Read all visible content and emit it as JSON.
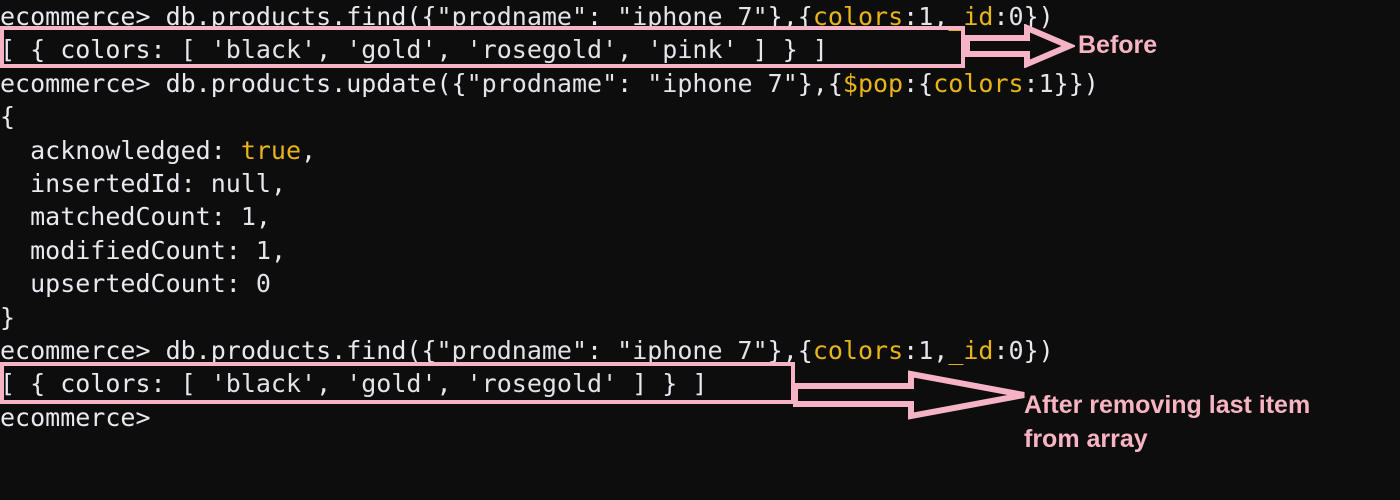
{
  "terminal": {
    "prompt": "ecommerce>",
    "background_color": "#0d0d0d",
    "colors": {
      "text": "#e8e8ee",
      "string": "#00b906",
      "key": "#e8b417",
      "number": "#e8b417",
      "annotation": "#f9b4c4",
      "highlight_border": "#f7b3c6"
    },
    "lines": [
      {
        "id": "l1",
        "kind": "command",
        "segments": [
          {
            "text": "ecommerce> ",
            "type": "prompt"
          },
          {
            "text": "db.products.find({",
            "type": "plain"
          },
          {
            "text": "\"prodname\"",
            "type": "string"
          },
          {
            "text": ": ",
            "type": "plain"
          },
          {
            "text": "\"iphone 7\"",
            "type": "string"
          },
          {
            "text": "},{",
            "type": "plain"
          },
          {
            "text": "colors",
            "type": "key"
          },
          {
            "text": ":",
            "type": "plain"
          },
          {
            "text": "1",
            "type": "number"
          },
          {
            "text": ",",
            "type": "plain"
          },
          {
            "text": "_id",
            "type": "key"
          },
          {
            "text": ":",
            "type": "plain"
          },
          {
            "text": "0",
            "type": "number"
          },
          {
            "text": "})",
            "type": "plain"
          }
        ]
      },
      {
        "id": "l2",
        "kind": "output",
        "segments": [
          {
            "text": "[ { colors: [ ",
            "type": "plain"
          },
          {
            "text": "'black'",
            "type": "string"
          },
          {
            "text": ", ",
            "type": "plain"
          },
          {
            "text": "'gold'",
            "type": "string"
          },
          {
            "text": ", ",
            "type": "plain"
          },
          {
            "text": "'rosegold'",
            "type": "string"
          },
          {
            "text": ", ",
            "type": "plain"
          },
          {
            "text": "'pink'",
            "type": "string"
          },
          {
            "text": " ] } ]",
            "type": "plain"
          }
        ]
      },
      {
        "id": "l3",
        "kind": "command",
        "segments": [
          {
            "text": "ecommerce> ",
            "type": "prompt"
          },
          {
            "text": "db.products.update({",
            "type": "plain"
          },
          {
            "text": "\"prodname\"",
            "type": "string"
          },
          {
            "text": ": ",
            "type": "plain"
          },
          {
            "text": "\"iphone 7\"",
            "type": "string"
          },
          {
            "text": "},{",
            "type": "plain"
          },
          {
            "text": "$pop",
            "type": "key"
          },
          {
            "text": ":{",
            "type": "plain"
          },
          {
            "text": "colors",
            "type": "key"
          },
          {
            "text": ":",
            "type": "plain"
          },
          {
            "text": "1",
            "type": "number"
          },
          {
            "text": "}})",
            "type": "plain"
          }
        ]
      },
      {
        "id": "l4",
        "kind": "output",
        "segments": [
          {
            "text": "{",
            "type": "plain"
          }
        ]
      },
      {
        "id": "l5",
        "kind": "output",
        "segments": [
          {
            "text": "  acknowledged: ",
            "type": "plain"
          },
          {
            "text": "true",
            "type": "bool"
          },
          {
            "text": ",",
            "type": "plain"
          }
        ]
      },
      {
        "id": "l6",
        "kind": "output",
        "segments": [
          {
            "text": "  insertedId: ",
            "type": "plain"
          },
          {
            "text": "null",
            "type": "null"
          },
          {
            "text": ",",
            "type": "plain"
          }
        ]
      },
      {
        "id": "l7",
        "kind": "output",
        "segments": [
          {
            "text": "  matchedCount: ",
            "type": "plain"
          },
          {
            "text": "1",
            "type": "number"
          },
          {
            "text": ",",
            "type": "plain"
          }
        ]
      },
      {
        "id": "l8",
        "kind": "output",
        "segments": [
          {
            "text": "  modifiedCount: ",
            "type": "plain"
          },
          {
            "text": "1",
            "type": "number"
          },
          {
            "text": ",",
            "type": "plain"
          }
        ]
      },
      {
        "id": "l9",
        "kind": "output",
        "segments": [
          {
            "text": "  upsertedCount: ",
            "type": "plain"
          },
          {
            "text": "0",
            "type": "number"
          }
        ]
      },
      {
        "id": "l10",
        "kind": "output",
        "segments": [
          {
            "text": "}",
            "type": "plain"
          }
        ]
      },
      {
        "id": "l11",
        "kind": "command",
        "segments": [
          {
            "text": "ecommerce> ",
            "type": "prompt"
          },
          {
            "text": "db.products.find({",
            "type": "plain"
          },
          {
            "text": "\"prodname\"",
            "type": "string"
          },
          {
            "text": ": ",
            "type": "plain"
          },
          {
            "text": "\"iphone 7\"",
            "type": "string"
          },
          {
            "text": "},{",
            "type": "plain"
          },
          {
            "text": "colors",
            "type": "key"
          },
          {
            "text": ":",
            "type": "plain"
          },
          {
            "text": "1",
            "type": "number"
          },
          {
            "text": ",",
            "type": "plain"
          },
          {
            "text": "_id",
            "type": "key"
          },
          {
            "text": ":",
            "type": "plain"
          },
          {
            "text": "0",
            "type": "number"
          },
          {
            "text": "})",
            "type": "plain"
          }
        ]
      },
      {
        "id": "l12",
        "kind": "output",
        "segments": [
          {
            "text": "[ { colors: [ ",
            "type": "plain"
          },
          {
            "text": "'black'",
            "type": "string"
          },
          {
            "text": ", ",
            "type": "plain"
          },
          {
            "text": "'gold'",
            "type": "string"
          },
          {
            "text": ", ",
            "type": "plain"
          },
          {
            "text": "'rosegold'",
            "type": "string"
          },
          {
            "text": " ] } ]",
            "type": "plain"
          }
        ]
      },
      {
        "id": "l13",
        "kind": "prompt",
        "segments": [
          {
            "text": "ecommerce>",
            "type": "prompt"
          }
        ]
      }
    ]
  },
  "annotations": {
    "before": {
      "label": "Before",
      "icon": "right-arrow-icon"
    },
    "after": {
      "label": "After removing last item\nfrom array",
      "label_line1": "After removing last item",
      "label_line2": "from array",
      "icon": "right-arrow-icon"
    }
  }
}
